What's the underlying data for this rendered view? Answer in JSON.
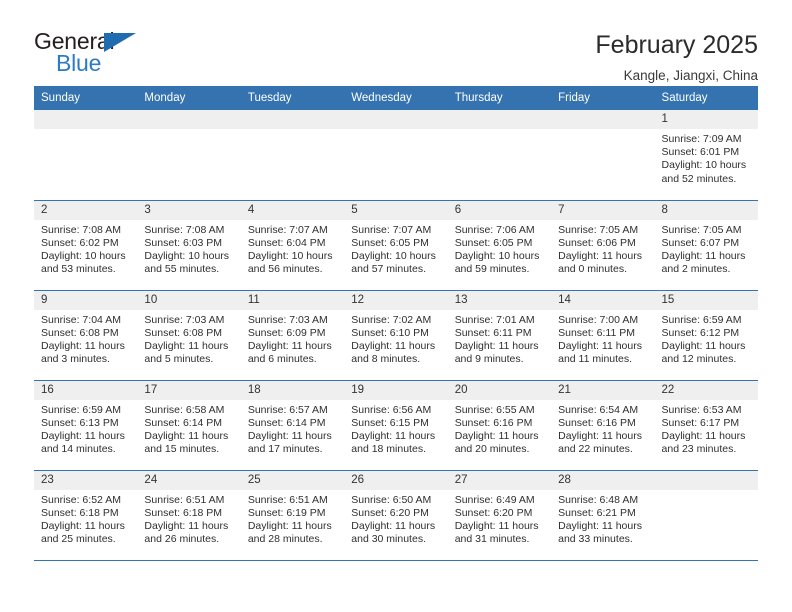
{
  "brand": {
    "name_part1": "General",
    "name_part2": "Blue",
    "flag_icon": "triangle-flag-icon",
    "accent_color": "#2b7cc4"
  },
  "header": {
    "title": "February 2025",
    "subtitle": "Kangle, Jiangxi, China"
  },
  "theme": {
    "header_blue": "#3572b0",
    "daynum_band": "#efefef",
    "text": "#2f2f2f"
  },
  "weekdays": [
    "Sunday",
    "Monday",
    "Tuesday",
    "Wednesday",
    "Thursday",
    "Friday",
    "Saturday"
  ],
  "weeks": [
    [
      {
        "day": "",
        "empty": true
      },
      {
        "day": "",
        "empty": true
      },
      {
        "day": "",
        "empty": true
      },
      {
        "day": "",
        "empty": true
      },
      {
        "day": "",
        "empty": true
      },
      {
        "day": "",
        "empty": true
      },
      {
        "day": "1",
        "sunrise": "Sunrise: 7:09 AM",
        "sunset": "Sunset: 6:01 PM",
        "daylight": "Daylight: 10 hours and 52 minutes."
      }
    ],
    [
      {
        "day": "2",
        "sunrise": "Sunrise: 7:08 AM",
        "sunset": "Sunset: 6:02 PM",
        "daylight": "Daylight: 10 hours and 53 minutes."
      },
      {
        "day": "3",
        "sunrise": "Sunrise: 7:08 AM",
        "sunset": "Sunset: 6:03 PM",
        "daylight": "Daylight: 10 hours and 55 minutes."
      },
      {
        "day": "4",
        "sunrise": "Sunrise: 7:07 AM",
        "sunset": "Sunset: 6:04 PM",
        "daylight": "Daylight: 10 hours and 56 minutes."
      },
      {
        "day": "5",
        "sunrise": "Sunrise: 7:07 AM",
        "sunset": "Sunset: 6:05 PM",
        "daylight": "Daylight: 10 hours and 57 minutes."
      },
      {
        "day": "6",
        "sunrise": "Sunrise: 7:06 AM",
        "sunset": "Sunset: 6:05 PM",
        "daylight": "Daylight: 10 hours and 59 minutes."
      },
      {
        "day": "7",
        "sunrise": "Sunrise: 7:05 AM",
        "sunset": "Sunset: 6:06 PM",
        "daylight": "Daylight: 11 hours and 0 minutes."
      },
      {
        "day": "8",
        "sunrise": "Sunrise: 7:05 AM",
        "sunset": "Sunset: 6:07 PM",
        "daylight": "Daylight: 11 hours and 2 minutes."
      }
    ],
    [
      {
        "day": "9",
        "sunrise": "Sunrise: 7:04 AM",
        "sunset": "Sunset: 6:08 PM",
        "daylight": "Daylight: 11 hours and 3 minutes."
      },
      {
        "day": "10",
        "sunrise": "Sunrise: 7:03 AM",
        "sunset": "Sunset: 6:08 PM",
        "daylight": "Daylight: 11 hours and 5 minutes."
      },
      {
        "day": "11",
        "sunrise": "Sunrise: 7:03 AM",
        "sunset": "Sunset: 6:09 PM",
        "daylight": "Daylight: 11 hours and 6 minutes."
      },
      {
        "day": "12",
        "sunrise": "Sunrise: 7:02 AM",
        "sunset": "Sunset: 6:10 PM",
        "daylight": "Daylight: 11 hours and 8 minutes."
      },
      {
        "day": "13",
        "sunrise": "Sunrise: 7:01 AM",
        "sunset": "Sunset: 6:11 PM",
        "daylight": "Daylight: 11 hours and 9 minutes."
      },
      {
        "day": "14",
        "sunrise": "Sunrise: 7:00 AM",
        "sunset": "Sunset: 6:11 PM",
        "daylight": "Daylight: 11 hours and 11 minutes."
      },
      {
        "day": "15",
        "sunrise": "Sunrise: 6:59 AM",
        "sunset": "Sunset: 6:12 PM",
        "daylight": "Daylight: 11 hours and 12 minutes."
      }
    ],
    [
      {
        "day": "16",
        "sunrise": "Sunrise: 6:59 AM",
        "sunset": "Sunset: 6:13 PM",
        "daylight": "Daylight: 11 hours and 14 minutes."
      },
      {
        "day": "17",
        "sunrise": "Sunrise: 6:58 AM",
        "sunset": "Sunset: 6:14 PM",
        "daylight": "Daylight: 11 hours and 15 minutes."
      },
      {
        "day": "18",
        "sunrise": "Sunrise: 6:57 AM",
        "sunset": "Sunset: 6:14 PM",
        "daylight": "Daylight: 11 hours and 17 minutes."
      },
      {
        "day": "19",
        "sunrise": "Sunrise: 6:56 AM",
        "sunset": "Sunset: 6:15 PM",
        "daylight": "Daylight: 11 hours and 18 minutes."
      },
      {
        "day": "20",
        "sunrise": "Sunrise: 6:55 AM",
        "sunset": "Sunset: 6:16 PM",
        "daylight": "Daylight: 11 hours and 20 minutes."
      },
      {
        "day": "21",
        "sunrise": "Sunrise: 6:54 AM",
        "sunset": "Sunset: 6:16 PM",
        "daylight": "Daylight: 11 hours and 22 minutes."
      },
      {
        "day": "22",
        "sunrise": "Sunrise: 6:53 AM",
        "sunset": "Sunset: 6:17 PM",
        "daylight": "Daylight: 11 hours and 23 minutes."
      }
    ],
    [
      {
        "day": "23",
        "sunrise": "Sunrise: 6:52 AM",
        "sunset": "Sunset: 6:18 PM",
        "daylight": "Daylight: 11 hours and 25 minutes."
      },
      {
        "day": "24",
        "sunrise": "Sunrise: 6:51 AM",
        "sunset": "Sunset: 6:18 PM",
        "daylight": "Daylight: 11 hours and 26 minutes."
      },
      {
        "day": "25",
        "sunrise": "Sunrise: 6:51 AM",
        "sunset": "Sunset: 6:19 PM",
        "daylight": "Daylight: 11 hours and 28 minutes."
      },
      {
        "day": "26",
        "sunrise": "Sunrise: 6:50 AM",
        "sunset": "Sunset: 6:20 PM",
        "daylight": "Daylight: 11 hours and 30 minutes."
      },
      {
        "day": "27",
        "sunrise": "Sunrise: 6:49 AM",
        "sunset": "Sunset: 6:20 PM",
        "daylight": "Daylight: 11 hours and 31 minutes."
      },
      {
        "day": "28",
        "sunrise": "Sunrise: 6:48 AM",
        "sunset": "Sunset: 6:21 PM",
        "daylight": "Daylight: 11 hours and 33 minutes."
      },
      {
        "day": "",
        "empty": true
      }
    ]
  ]
}
